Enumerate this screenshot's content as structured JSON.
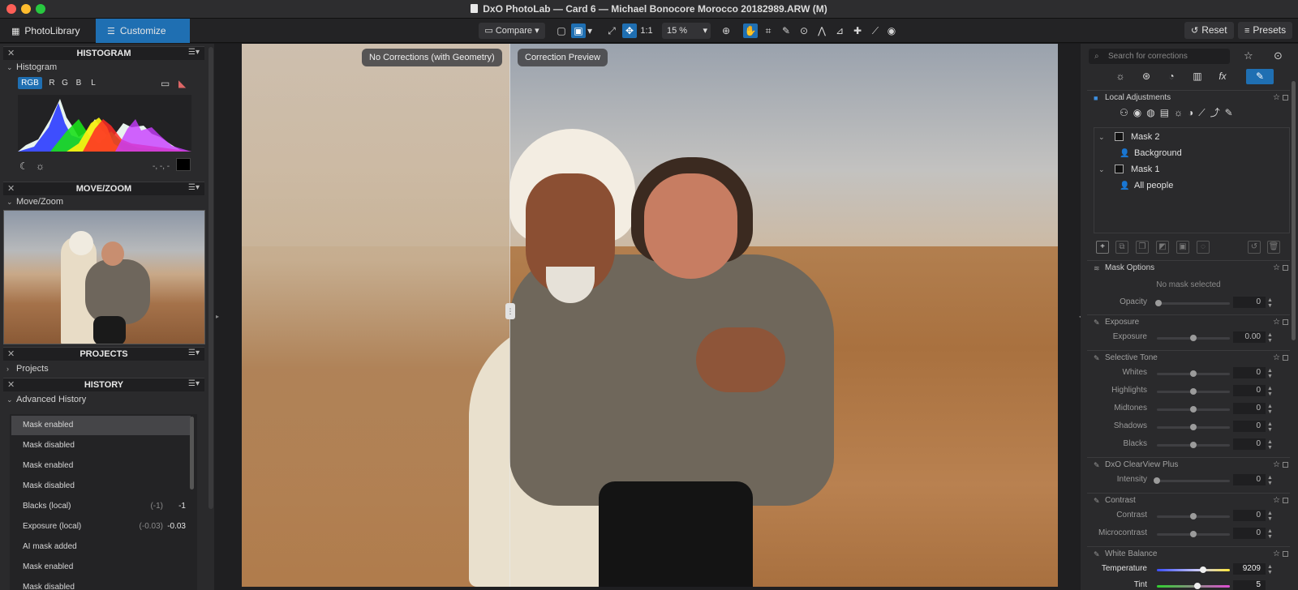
{
  "window": {
    "title": "DxO PhotoLab — Card 6 — Michael Bonocore Morocco 20182989.ARW (M)"
  },
  "toolbar": {
    "tab_library": "PhotoLibrary",
    "tab_customize": "Customize",
    "compare_label": "Compare",
    "one_to_one": "1:1",
    "zoom_value": "15 %",
    "reset_label": "Reset",
    "presets_label": "Presets",
    "icons": [
      "single-view-icon",
      "split-view-icon",
      "fit-icon",
      "move-icon",
      "zoom-in-icon",
      "hand-icon",
      "crop-icon",
      "eyedropper-icon",
      "redeye-icon",
      "perspective-icon",
      "horizon-icon",
      "repair-icon",
      "local-adjust-icon",
      "eye-icon"
    ]
  },
  "left": {
    "histogram": {
      "header": "HISTOGRAM",
      "sub": "Histogram",
      "channels": [
        "RGB",
        "R",
        "G",
        "B",
        "L"
      ],
      "readout": "-, -, -"
    },
    "movezoom": {
      "header": "MOVE/ZOOM",
      "sub": "Move/Zoom"
    },
    "projects": {
      "header": "PROJECTS",
      "sub": "Projects"
    },
    "history": {
      "header": "HISTORY",
      "sub": "Advanced History",
      "items": [
        {
          "label": "Mask enabled",
          "old": "",
          "new": ""
        },
        {
          "label": "Mask disabled",
          "old": "",
          "new": ""
        },
        {
          "label": "Mask enabled",
          "old": "",
          "new": ""
        },
        {
          "label": "Mask disabled",
          "old": "",
          "new": ""
        },
        {
          "label": "Blacks (local)",
          "old": "(-1)",
          "new": "-1"
        },
        {
          "label": "Exposure (local)",
          "old": "(-0.03)",
          "new": "-0.03"
        },
        {
          "label": "AI mask added",
          "old": "",
          "new": ""
        },
        {
          "label": "Mask enabled",
          "old": "",
          "new": ""
        },
        {
          "label": "Mask disabled",
          "old": "",
          "new": ""
        }
      ]
    }
  },
  "viewer": {
    "before_label": "No Corrections (with Geometry)",
    "after_label": "Correction Preview"
  },
  "right": {
    "search_placeholder": "Search for corrections",
    "local_adjustments": "Local Adjustments",
    "masks": [
      {
        "name": "Mask 2",
        "child": "Background"
      },
      {
        "name": "Mask 1",
        "child": "All people"
      }
    ],
    "mask_options": {
      "title": "Mask Options",
      "empty": "No mask selected",
      "opacity_label": "Opacity",
      "opacity_value": "0"
    },
    "exposure": {
      "title": "Exposure",
      "label": "Exposure",
      "value": "0.00"
    },
    "selective_tone": {
      "title": "Selective Tone",
      "rows": [
        {
          "label": "Whites",
          "value": "0"
        },
        {
          "label": "Highlights",
          "value": "0"
        },
        {
          "label": "Midtones",
          "value": "0"
        },
        {
          "label": "Shadows",
          "value": "0"
        },
        {
          "label": "Blacks",
          "value": "0"
        }
      ]
    },
    "clearview": {
      "title": "DxO ClearView Plus",
      "label": "Intensity",
      "value": "0"
    },
    "contrast": {
      "title": "Contrast",
      "rows": [
        {
          "label": "Contrast",
          "value": "0"
        },
        {
          "label": "Microcontrast",
          "value": "0"
        }
      ]
    },
    "white_balance": {
      "title": "White Balance",
      "temp_label": "Temperature",
      "temp_value": "9209",
      "tint_label": "Tint",
      "tint_value": "5"
    }
  },
  "colors": {
    "accent": "#1f6fb2",
    "panel": "#2a2a2c",
    "header": "#1f1f21"
  }
}
